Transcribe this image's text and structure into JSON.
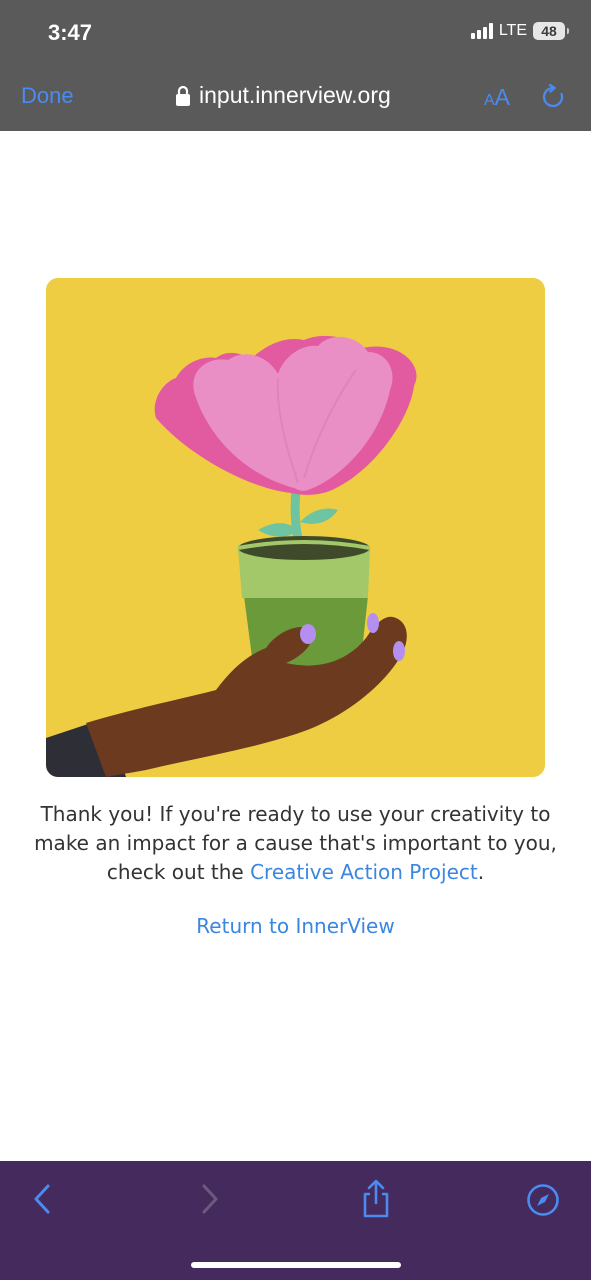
{
  "status_bar": {
    "time": "3:47",
    "network": "LTE",
    "battery": "48"
  },
  "browser": {
    "done_label": "Done",
    "url": "input.innerview.org",
    "text_size_small": "A",
    "text_size_big": "A",
    "accent_color": "#4a8bf0"
  },
  "content": {
    "illustration_icons": [
      "flower",
      "flower-pot",
      "hand"
    ],
    "message_before_link": "Thank you! If you're ready to use your creativity to make an impact for a cause that's important to you, check out the ",
    "link_text": "Creative Action Project",
    "message_after_link": ".",
    "return_link": "Return to InnerView",
    "link_color": "#3b86e0",
    "illustration_background": "#efcd43"
  },
  "bottom_toolbar": {
    "background": "#452a5e",
    "icons": [
      "back-icon",
      "forward-icon",
      "share-icon",
      "compass-icon"
    ]
  }
}
